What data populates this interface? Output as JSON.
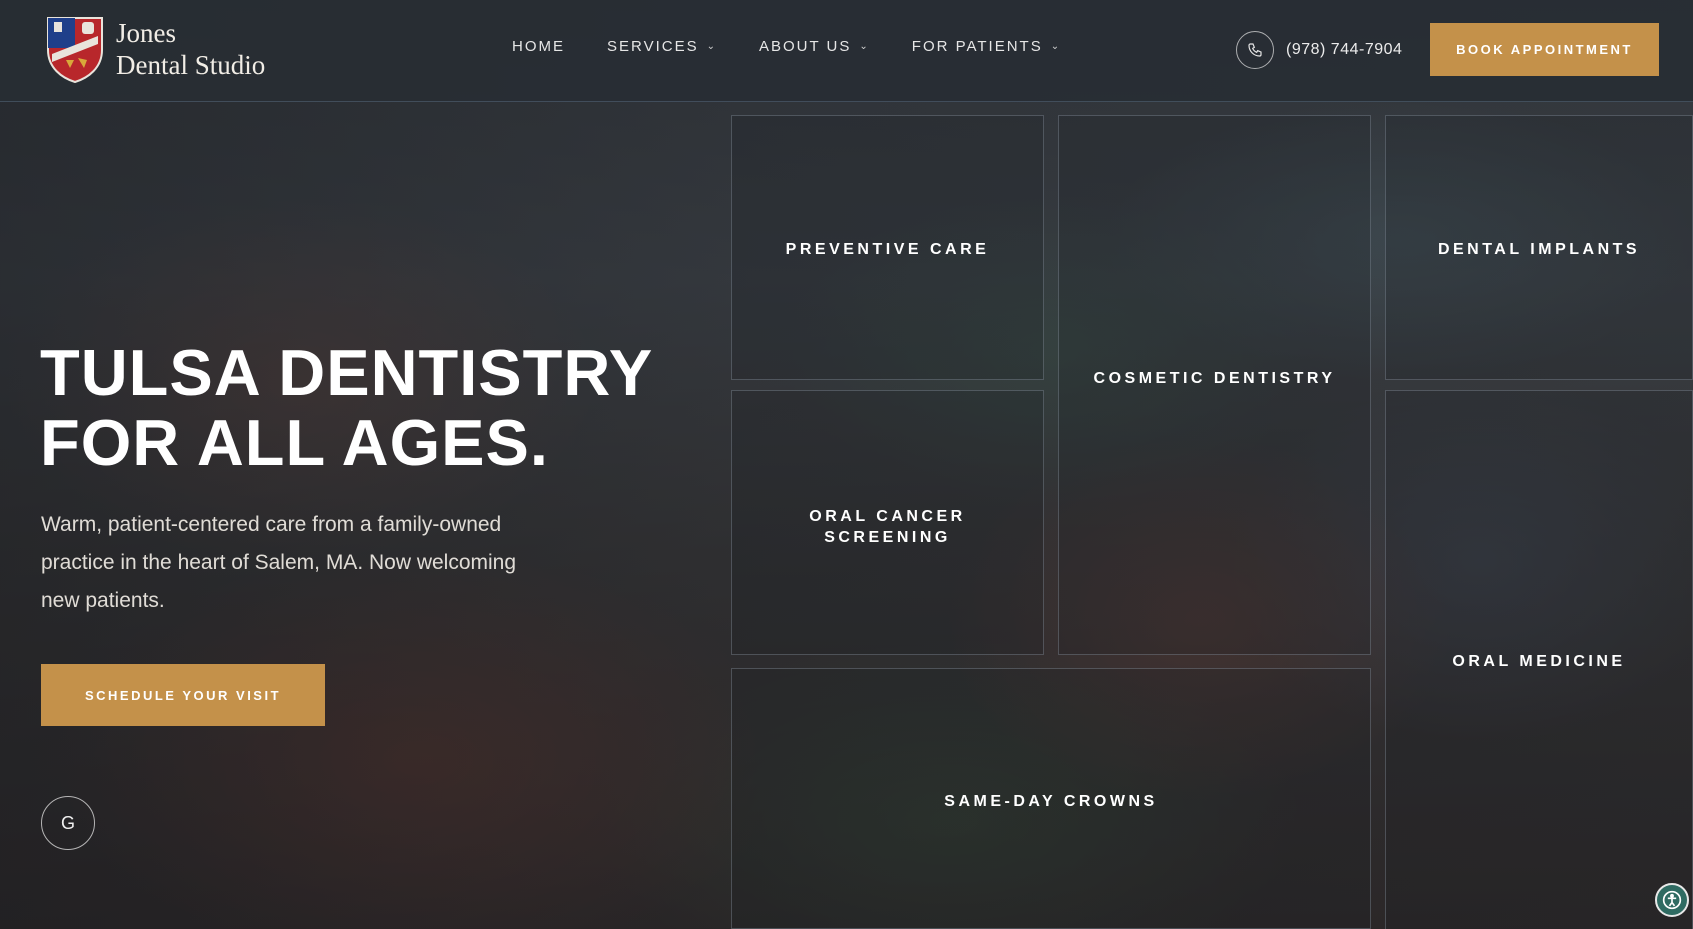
{
  "brand": {
    "line1": "Jones",
    "line2": "Dental Studio"
  },
  "nav": {
    "items": [
      {
        "label": "HOME",
        "has_dropdown": false
      },
      {
        "label": "SERVICES",
        "has_dropdown": true
      },
      {
        "label": "ABOUT US",
        "has_dropdown": true
      },
      {
        "label": "FOR PATIENTS",
        "has_dropdown": true
      }
    ]
  },
  "contact": {
    "phone": "(978) 744-7904",
    "phone_icon": "phone-icon"
  },
  "header_cta": {
    "label": "BOOK APPOINTMENT"
  },
  "hero": {
    "title_line1": "TULSA DENTISTRY",
    "title_line2": "FOR ALL AGES.",
    "subtitle": "Warm, patient-centered care from a family-owned practice in the heart of Salem, MA. Now welcoming new patients.",
    "cta_label": "SCHEDULE YOUR VISIT",
    "badge_letter": "G"
  },
  "services": [
    "PREVENTIVE CARE",
    "COSMETIC DENTISTRY",
    "DENTAL IMPLANTS",
    "ORAL CANCER SCREENING",
    "ORAL MEDICINE",
    "SAME-DAY CROWNS"
  ],
  "colors": {
    "accent": "#c4914a",
    "header_bg": "#2b3036",
    "accessibility": "#2f6b62"
  }
}
